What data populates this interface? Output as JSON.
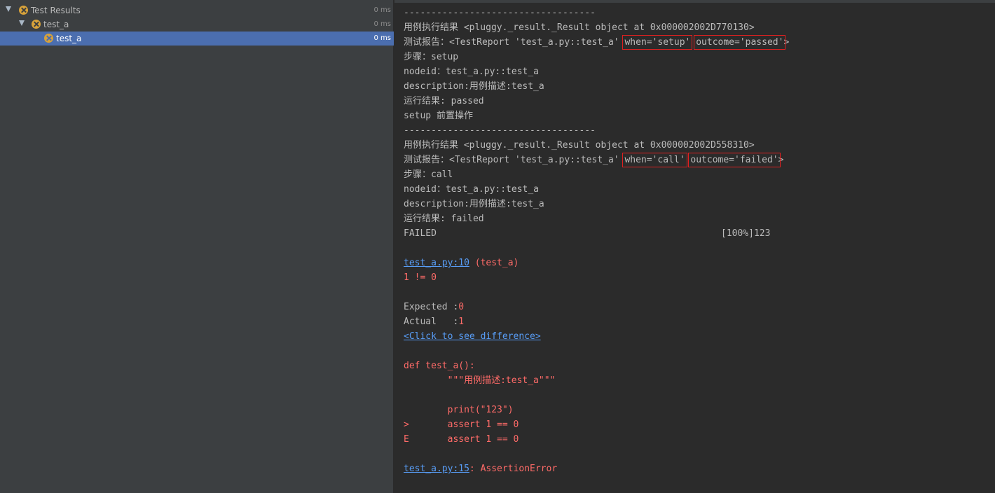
{
  "tree": {
    "root": {
      "label": "Test Results",
      "duration": "0 ms"
    },
    "module": {
      "label": "test_a",
      "duration": "0 ms"
    },
    "test": {
      "label": "test_a",
      "duration": "0 ms"
    }
  },
  "console": {
    "sep1": "-----------------------------------",
    "hook1": "用例执行结果 <pluggy._result._Result object at 0x000002002D770130>",
    "report1_prefix": "测试报告：<TestReport 'test_a.py::test_a' ",
    "report1_when": "when='setup'",
    "report1_space": " ",
    "report1_outcome": "outcome='passed'",
    "report1_end": ">",
    "step1": "步骤：setup",
    "nodeid1": "nodeid：test_a.py::test_a",
    "desc1": "description:用例描述:test_a",
    "result1": "运行结果: passed",
    "setup_msg": "setup 前置操作",
    "sep2": "-----------------------------------",
    "hook2": "用例执行结果 <pluggy._result._Result object at 0x000002002D558310>",
    "report2_prefix": "测试报告：<TestReport 'test_a.py::test_a' ",
    "report2_when": "when='call'",
    "report2_space": " ",
    "report2_outcome": "outcome='failed'",
    "report2_end": ">",
    "step2": "步骤：call",
    "nodeid2": "nodeid：test_a.py::test_a",
    "desc2": "description:用例描述:test_a",
    "result2": "运行结果: failed",
    "failed": "FAILED",
    "percent": "[100%]123",
    "loc1_link": "test_a.py:10",
    "loc1_rest": " (test_a)",
    "neq": "1 != 0",
    "expected_label": "Expected :",
    "expected_val": "0",
    "actual_label": "Actual   :",
    "actual_val": "1",
    "diff_link": "<Click to see difference>",
    "code1": "def test_a():",
    "code2": "        \"\"\"用例描述:test_a\"\"\"",
    "code3": "        print(\"123\")",
    "code4": ">       assert 1 == 0",
    "code5": "E       assert 1 == 0",
    "loc2_link": "test_a.py:15",
    "loc2_rest": ": AssertionError"
  },
  "colors": {
    "error": "#ff6b68",
    "link": "#589df6",
    "selection": "#4b6eaf",
    "highlight_box": "#e02020"
  }
}
